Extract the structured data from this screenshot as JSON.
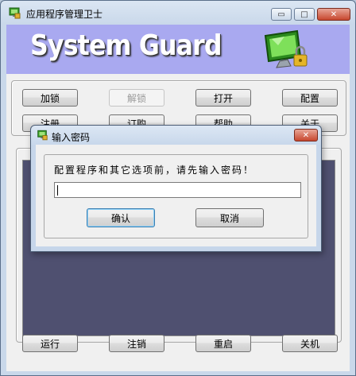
{
  "window": {
    "title": "应用程序管理卫士",
    "minimize": "▭",
    "maximize": "□",
    "close": "✕"
  },
  "banner": {
    "title": "System Guard"
  },
  "row1": [
    {
      "label": "加锁",
      "name": "lock-button"
    },
    {
      "label": "解锁",
      "name": "unlock-button"
    },
    {
      "label": "打开",
      "name": "open-button"
    },
    {
      "label": "配置",
      "name": "config-button"
    }
  ],
  "row2": [
    {
      "label": "注册",
      "name": "register-button"
    },
    {
      "label": "订购",
      "name": "order-button"
    },
    {
      "label": "帮助",
      "name": "help-button"
    },
    {
      "label": "关于",
      "name": "about-button"
    }
  ],
  "bottom": [
    {
      "label": "运行",
      "name": "run-button"
    },
    {
      "label": "注销",
      "name": "logoff-button"
    },
    {
      "label": "重启",
      "name": "restart-button"
    },
    {
      "label": "关机",
      "name": "shutdown-button"
    }
  ],
  "dialog": {
    "title": "输入密码",
    "close": "✕",
    "prompt": "配置程序和其它选项前，请先输入密码！",
    "password_value": "",
    "ok": "确认",
    "cancel": "取消"
  },
  "colors": {
    "banner": "#a9a9f0",
    "panel": "#4f5070"
  }
}
